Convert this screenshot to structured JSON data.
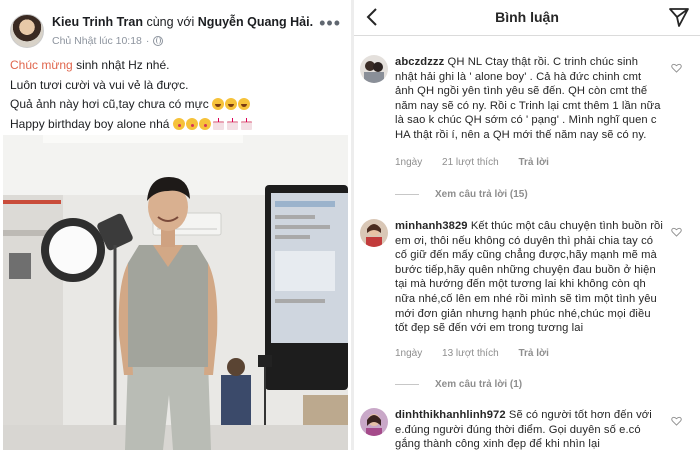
{
  "post": {
    "author": "Kieu Trinh Tran",
    "with_text": "cùng với",
    "tagged": "Nguyễn Quang Hải",
    "timestamp": "Chủ Nhật lúc 10:18",
    "separator": "·",
    "more_icon": "more-dots-icon",
    "line1_highlight": "Chúc mừng",
    "line1_rest": " sinh nhật Hz nhé.",
    "line2": "Luôn tươi cười và vui vẻ là được.",
    "line3": "Quả ảnh này hơi cũ,tay chưa có mực ",
    "line4": "Happy birthday boy alone nhá "
  },
  "comments_panel": {
    "title": "Bình luận",
    "back_icon": "chevron-left-icon",
    "send_icon": "paper-plane-icon",
    "comments": [
      {
        "username": "abczdzzz",
        "text": "QH NL Ctay thật rồi. C trinh chúc sinh nhật hải ghi là ' alone boy' . Cả hà đức chinh cmt ảnh QH ngồi yên tình yêu sẽ đến. QH còn cmt thế năm nay sẽ có ny. Rồi c Trinh lại cmt thêm 1 lần nữa là sao k chúc QH sớm có ' pạng' . Mình nghĩ quen c HA thật rồi í, nên a QH mới thế năm nay sẽ có ny.",
        "age": "1ngày",
        "likes": "21 lượt thích",
        "reply": "Trả lời",
        "view_replies": "Xem câu trả lời (15)"
      },
      {
        "username": "minhanh3829",
        "text": "Kết thúc một câu chuyện tình buồn rồi em ơi, thôi nếu không có duyên thì phải chia tay có cố giữ đến mấy cũng chẳng được,hãy mạnh mẽ mà bước tiếp,hãy quên những chuyện đau buồn ở hiện tại mà hướng đến một tương lai khi không còn qh nữa nhé,cố lên em nhé rồi mình sẽ tìm một tình yêu mới đơn giản nhưng hạnh phúc nhé,chúc mọi điều tốt đẹp sẽ đến với em trong tương lai",
        "age": "1ngày",
        "likes": "13 lượt thích",
        "reply": "Trả lời",
        "view_replies": "Xem câu trả lời (1)"
      },
      {
        "username": "dinhthikhanhlinh972",
        "text": "Sẽ có người tốt hơn đến với e.đúng người đúng thời điểm. Gọi duyên số e.có gắng thành công xinh đẹp để khi nhìn lại"
      }
    ]
  },
  "colors": {
    "highlight": "#e0664d",
    "meta_gray": "#8e8e8e",
    "text": "#262626"
  }
}
